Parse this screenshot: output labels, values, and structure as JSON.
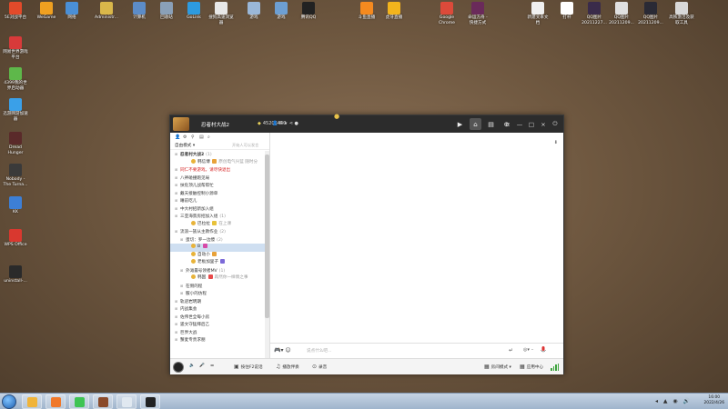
{
  "desktop": {
    "icons": [
      {
        "label": "5E对战平台",
        "color": "#e24a2a"
      },
      {
        "label": "WeGame",
        "color": "#f0a020"
      },
      {
        "label": "网络",
        "color": "#4a8fd6"
      },
      {
        "label": "Administr...",
        "color": "#d9b74a"
      },
      {
        "label": "计算机",
        "color": "#5c8cc8"
      },
      {
        "label": "回收站",
        "color": "#8aa0b8"
      },
      {
        "label": "GoLink",
        "color": "#2d9be0"
      },
      {
        "label": "搜狗高速浏览\n器",
        "color": "#e8e8e8"
      },
      {
        "label": "游戏",
        "color": "#9ab7d8"
      },
      {
        "label": "游戏",
        "color": "#6d9fd3"
      },
      {
        "label": "腾讯QQ",
        "color": "#222222"
      },
      {
        "label": "斗鱼直播",
        "color": "#f58a1f"
      },
      {
        "label": "虎牙直播",
        "color": "#f3b41c"
      },
      {
        "label": "Google\nChrome",
        "color": "#dc4a3a"
      },
      {
        "label": "命运方舟 -\n快捷方式",
        "color": "#6a2a5a"
      },
      {
        "label": "新建文本文\n档",
        "color": "#f0f0f0"
      },
      {
        "label": "打杆",
        "color": "#ffffff"
      },
      {
        "label": "QQ图片\n20211227...",
        "color": "#3a2b4a"
      },
      {
        "label": "QQ图片\n20211209...",
        "color": "#e0e0e0"
      },
      {
        "label": "QQ图片\n20211209...",
        "color": "#2a2a35"
      },
      {
        "label": "高铁激活及获\n取工具",
        "color": "#d8d8d8"
      },
      {
        "label": "网易世界游戏\n平台",
        "color": "#d83a3a"
      },
      {
        "label": "4399我的世\n界启动器",
        "color": "#5eb84a"
      },
      {
        "label": "迅游网游加速\n器",
        "color": "#3aa0e8"
      },
      {
        "label": "Dread\nHunger",
        "color": "#5a2a2a"
      },
      {
        "label": "Nobody -\nThe Turna...",
        "color": "#3a3a3a"
      },
      {
        "label": "KK",
        "color": "#3d7fd6"
      },
      {
        "label": "WPS Office",
        "color": "#d9382f"
      },
      {
        "label": "uninstall-...",
        "color": "#2a2a2a"
      }
    ]
  },
  "window": {
    "title": "忍者村大战2",
    "room_id": "45206440",
    "user_count": "6",
    "tool_icons": [
      "video-icon",
      "chat-icon",
      "home-icon",
      "list-icon",
      "gamepad-icon"
    ],
    "controls": {
      "menu": "≡",
      "min": "—",
      "max": "□",
      "close": "×",
      "power": "⏻"
    }
  },
  "left_panel": {
    "mode_label": "自由模式 ▾",
    "search_placeholder": "开始人可以发言",
    "tree": [
      {
        "text": "忍者村大战2",
        "suffix": "(1)",
        "indent": 0,
        "type": "group",
        "bold": true
      },
      {
        "text": "韩信傅 ",
        "suffix": "原创电气兴蓝  随时分",
        "indent": 2,
        "type": "user",
        "badge": "#e8a23a"
      },
      {
        "text": "同仁不要游戏，请尽快退出",
        "suffix": "",
        "indent": 0,
        "type": "red"
      },
      {
        "text": "八神碰撞跑见局",
        "suffix": "",
        "indent": 0,
        "type": "group"
      },
      {
        "text": "扶危顶儿战帮帮忙",
        "suffix": "",
        "indent": 0,
        "type": "group"
      },
      {
        "text": "戴天接触控制小源单",
        "suffix": "",
        "indent": 0,
        "type": "group"
      },
      {
        "text": "睡前吃儿",
        "suffix": "",
        "indent": 0,
        "type": "group"
      },
      {
        "text": "中大村招新加入组",
        "suffix": "",
        "indent": 0,
        "type": "group"
      },
      {
        "text": "三亚海景房招加入组",
        "suffix": "(1)",
        "indent": 0,
        "type": "group"
      },
      {
        "text": "巴拉拉 ",
        "suffix": "在上课",
        "indent": 2,
        "type": "user",
        "badge": "#e8c23a"
      },
      {
        "text": "流浪一族从主教作业",
        "suffix": "(2)",
        "indent": 0,
        "type": "group"
      },
      {
        "text": "蛋切：罗一边傻",
        "suffix": "(2)",
        "indent": 1,
        "type": "group"
      },
      {
        "text": "B ",
        "suffix": "",
        "indent": 2,
        "type": "user",
        "badge": "#d64aa8",
        "selected": true
      },
      {
        "text": "自动小 ",
        "suffix": "",
        "indent": 2,
        "type": "user",
        "badge": "#e8a23a"
      },
      {
        "text": "老板加里子 ",
        "suffix": "",
        "indent": 2,
        "type": "user",
        "badge": "#7c6ad8"
      },
      {
        "text": "外滩最号领者MV",
        "suffix": "(1)",
        "indent": 1,
        "type": "group"
      },
      {
        "text": "韩国 ",
        "suffix": "再然你一样情之事",
        "indent": 2,
        "type": "user",
        "badge": "#e84a4a"
      },
      {
        "text": "在侧的程",
        "suffix": "",
        "indent": 1,
        "type": "group"
      },
      {
        "text": "服小的仿程",
        "suffix": "",
        "indent": 1,
        "type": "group"
      },
      {
        "text": "轨迹岩明期",
        "suffix": "",
        "indent": 0,
        "type": "group"
      },
      {
        "text": "内战集会",
        "suffix": "",
        "indent": 0,
        "type": "group"
      },
      {
        "text": "佐伟世全每小房",
        "suffix": "",
        "indent": 0,
        "type": "group"
      },
      {
        "text": "遥文守猛拜后乙",
        "suffix": "",
        "indent": 0,
        "type": "group"
      },
      {
        "text": "巨界大战",
        "suffix": "",
        "indent": 0,
        "type": "group"
      },
      {
        "text": "蟹麦专责求朋",
        "suffix": "",
        "indent": 0,
        "type": "group"
      }
    ]
  },
  "main": {
    "pin_icon": "pin-icon"
  },
  "input": {
    "placeholder": "说点什么吧..."
  },
  "bottom_toolbar": {
    "items": [
      {
        "label": "按住F2说话",
        "icon": "▣"
      },
      {
        "label": "播放伴奏",
        "icon": "♫"
      },
      {
        "label": "录音",
        "icon": "⊙"
      },
      {
        "label": "房间模式 ▾",
        "icon": "▦"
      },
      {
        "label": "应用中心",
        "icon": "▦"
      }
    ]
  },
  "taskbar": {
    "time": "16:00",
    "date": "2022/4/26",
    "apps": [
      {
        "name": "qq-app",
        "color": "#f0b43a"
      },
      {
        "name": "app-orange",
        "color": "#f0782a"
      },
      {
        "name": "app-wechat",
        "color": "#3ec454"
      },
      {
        "name": "app-game",
        "color": "#8a4a2a"
      },
      {
        "name": "app-window",
        "color": "#e0e8f0"
      },
      {
        "name": "app-yy",
        "color": "#222222"
      }
    ]
  }
}
